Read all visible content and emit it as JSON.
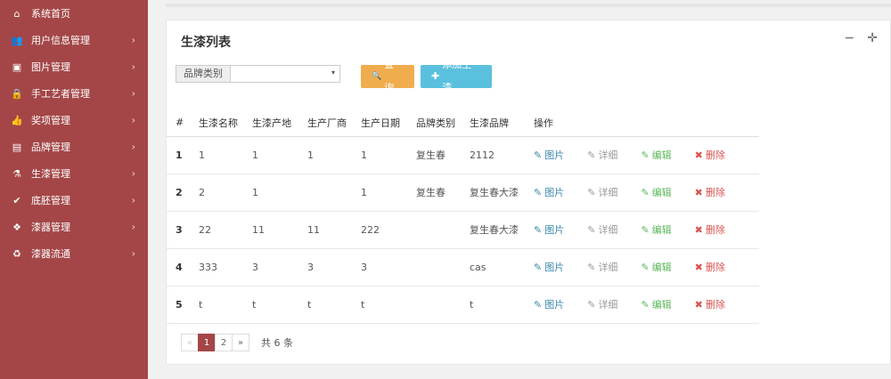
{
  "sidebar": {
    "items": [
      {
        "icon": "home-icon",
        "glyph": "⌂",
        "label": "系统首页",
        "arrow": false
      },
      {
        "icon": "users-icon",
        "glyph": "👥",
        "label": "用户信息管理",
        "arrow": true
      },
      {
        "icon": "picture-icon",
        "glyph": "▣",
        "label": "图片管理",
        "arrow": true
      },
      {
        "icon": "lock-icon",
        "glyph": "🔒",
        "label": "手工艺者管理",
        "arrow": true
      },
      {
        "icon": "thumbs-up-icon",
        "glyph": "👍",
        "label": "奖项管理",
        "arrow": true
      },
      {
        "icon": "card-icon",
        "glyph": "▤",
        "label": "品牌管理",
        "arrow": true
      },
      {
        "icon": "flask-icon",
        "glyph": "⚗",
        "label": "生漆管理",
        "arrow": true
      },
      {
        "icon": "check-circle-icon",
        "glyph": "✔",
        "label": "底胚管理",
        "arrow": true
      },
      {
        "icon": "cubes-icon",
        "glyph": "❖",
        "label": "漆器管理",
        "arrow": true
      },
      {
        "icon": "recycle-icon",
        "glyph": "♻",
        "label": "漆器流通",
        "arrow": true
      }
    ],
    "arrow_glyph": "›"
  },
  "panel": {
    "title": "生漆列表",
    "tool_minimize": "−",
    "tool_move": "✛"
  },
  "filter": {
    "label": "品牌类别",
    "selected": "",
    "caret": "▾"
  },
  "buttons": {
    "query_icon": "🔍",
    "query": "查询",
    "add_icon": "✚",
    "add": "添加生漆"
  },
  "table": {
    "headers": [
      "#",
      "生漆名称",
      "生漆产地",
      "生产厂商",
      "生产日期",
      "品牌类别",
      "生漆品牌",
      "操作"
    ],
    "rows": [
      {
        "no": "1",
        "name": "1",
        "origin": "1",
        "maker": "1",
        "date": "1",
        "category": "复生春",
        "brand": "2112"
      },
      {
        "no": "2",
        "name": "2",
        "origin": "1",
        "maker": "",
        "date": "1",
        "category": "复生春",
        "brand": "复生春大漆"
      },
      {
        "no": "3",
        "name": "22",
        "origin": "11",
        "maker": "11",
        "date": "222",
        "category": "",
        "brand": "复生春大漆"
      },
      {
        "no": "4",
        "name": "333",
        "origin": "3",
        "maker": "3",
        "date": "3",
        "category": "",
        "brand": "cas"
      },
      {
        "no": "5",
        "name": "t",
        "origin": "t",
        "maker": "t",
        "date": "t",
        "category": "",
        "brand": "t"
      }
    ],
    "actions": {
      "pic_icon": "✎",
      "pic": "图片",
      "detail_icon": "✎",
      "detail": "详细",
      "edit_icon": "✎",
      "edit": "编辑",
      "del_icon": "✖",
      "del": "删除"
    }
  },
  "pager": {
    "prev": "«",
    "pages": [
      "1",
      "2"
    ],
    "next": "»",
    "total": "共 6 条"
  },
  "colors": {
    "sidebar": "#a44647",
    "query_button": "#f0ad4e",
    "add_button": "#5bc0de"
  }
}
